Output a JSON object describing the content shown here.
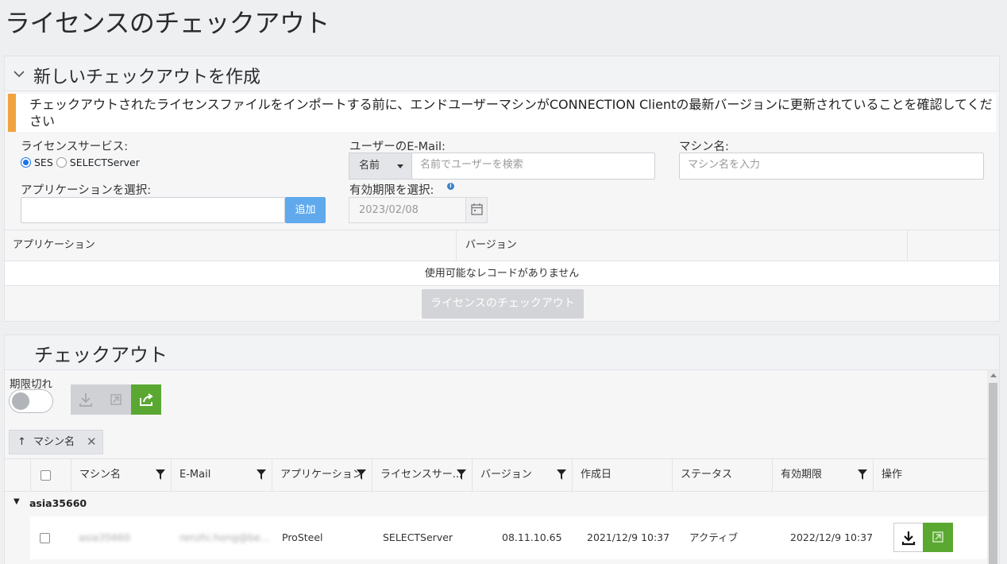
{
  "page": {
    "title": "ライセンスのチェックアウト"
  },
  "create_panel": {
    "title": "新しいチェックアウトを作成",
    "alert": "チェックアウトされたライセンスファイルをインポートする前に、エンドユーザーマシンがCONNECTION Clientの最新バージョンに更新されていることを確認してください",
    "license_service_label": "ライセンスサービス:",
    "radio_ses": "SES",
    "radio_select": "SELECTServer",
    "user_email_label": "ユーザーのE-Mail:",
    "user_dropdown_value": "名前",
    "user_search_placeholder": "名前でユーザーを検索",
    "machine_name_label": "マシン名:",
    "machine_name_placeholder": "マシン名を入力",
    "application_label": "アプリケーションを選択:",
    "add_button": "追加",
    "expiry_label": "有効期限を選択:",
    "expiry_value": "2023/02/08",
    "grid_headers": [
      "アプリケーション",
      "バージョン"
    ],
    "empty_text": "使用可能なレコードがありません",
    "checkout_button": "ライセンスのチェックアウト"
  },
  "checkout_panel": {
    "title": "チェックアウト",
    "expired_label": "期限切れ",
    "sort_chip": "マシン名",
    "columns": [
      "マシン名",
      "E-Mail",
      "アプリケーション",
      "ライセンスサー...",
      "バージョン",
      "作成日",
      "ステータス",
      "有効期限",
      "操作"
    ],
    "group": "asia35660",
    "row": {
      "machine": "asia35660",
      "email": "renzhi.hong@be...",
      "application": "ProSteel",
      "license_service": "SELECTServer",
      "version": "08.11.10.65",
      "created": "2021/12/9 10:37",
      "status": "アクティブ",
      "expiry": "2022/12/9 10:37"
    }
  },
  "colors": {
    "accent_blue": "#5fa9ec",
    "green": "#5aa832",
    "alert_orange": "#f1a33f"
  }
}
